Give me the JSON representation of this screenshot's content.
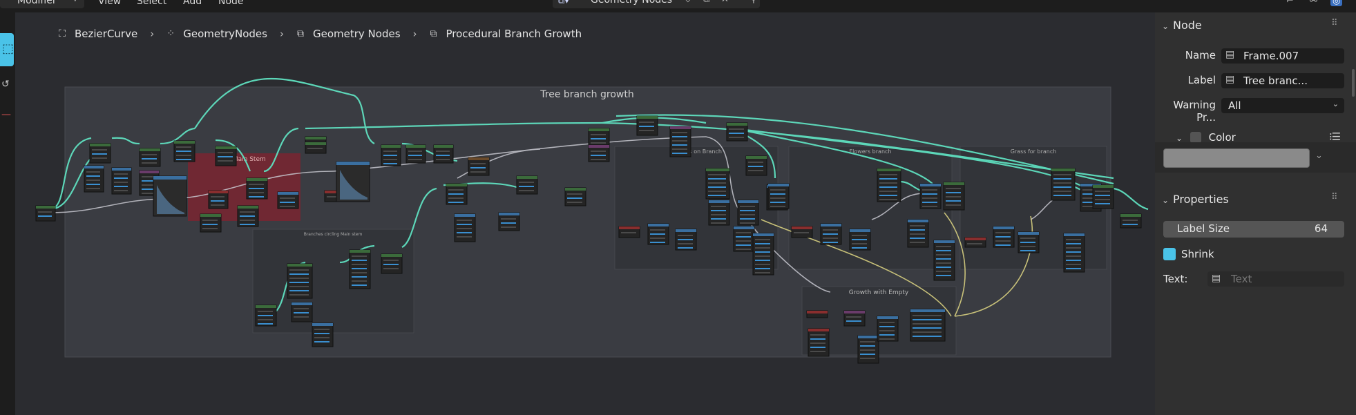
{
  "header": {
    "editor_mode": "Modifier",
    "menus": [
      "View",
      "Select",
      "Add",
      "Node"
    ],
    "node_tree_name": "Geometry Nodes"
  },
  "breadcrumb": [
    {
      "label": "BezierCurve",
      "icon": "curve-object-icon"
    },
    {
      "label": "GeometryNodes",
      "icon": "geometry-nodes-modifier-icon"
    },
    {
      "label": "Geometry Nodes",
      "icon": "node-tree-icon"
    },
    {
      "label": "Procedural Branch Growth",
      "icon": "node-group-icon"
    }
  ],
  "canvas": {
    "frames": {
      "main": "Tree branch growth",
      "uv_stem": "UV Main Stem",
      "branches": "Branches circling Main stem",
      "flowers": "Flowers on Branch",
      "flowers2": "Flowers branch",
      "grass": "Grass for branch",
      "empty": "Growth with Empty"
    }
  },
  "sidebar": {
    "node_section": {
      "title": "Node",
      "name_label": "Name",
      "name_value": "Frame.007",
      "label_label": "Label",
      "label_value": "Tree branc...",
      "warning_label": "Warning Pr...",
      "warning_value": "All"
    },
    "color_section": {
      "title": "Color",
      "color": "#8a8a8a"
    },
    "properties_section": {
      "title": "Properties",
      "label_size_label": "Label Size",
      "label_size_value": "64",
      "shrink_label": "Shrink",
      "text_label": "Text:",
      "text_placeholder": "Text"
    }
  },
  "colors": {
    "link_geometry": "#5fe0c0",
    "link_float": "#c8c8d0",
    "link_vector": "#d8d080",
    "accent": "#4ac3e8",
    "frame_red": "#7a2530"
  }
}
